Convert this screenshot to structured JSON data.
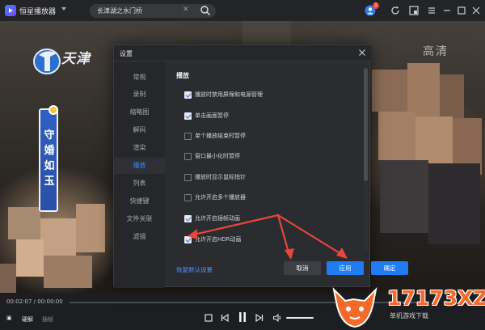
{
  "app": {
    "name": "恒星播放器"
  },
  "search": {
    "query": "长津湖之水门桥"
  },
  "notifications": {
    "count": "1"
  },
  "video": {
    "channel_logo_text": "天津",
    "quality_badge": "高清",
    "drama_title": "守婚如玉"
  },
  "dialog": {
    "title": "设置",
    "nav": [
      {
        "label": "常规"
      },
      {
        "label": "录制"
      },
      {
        "label": "缩略图"
      },
      {
        "label": "解码"
      },
      {
        "label": "渲染"
      },
      {
        "label": "播放"
      },
      {
        "label": "列表"
      },
      {
        "label": "快捷键"
      },
      {
        "label": "文件关联"
      },
      {
        "label": "滤镜"
      }
    ],
    "active_nav": "播放",
    "section_title": "播放",
    "options": [
      {
        "label": "播放时禁用屏保和电源管理",
        "checked": true
      },
      {
        "label": "单击画面暂停",
        "checked": true
      },
      {
        "label": "单个播放结束时暂停",
        "checked": false
      },
      {
        "label": "窗口最小化时暂停",
        "checked": false
      },
      {
        "label": "播放时显示鼠标指针",
        "checked": false
      },
      {
        "label": "允许开启多个播放器",
        "checked": false
      },
      {
        "label": "允许开启插帧动画",
        "checked": true
      },
      {
        "label": "允许开启HDR动画",
        "checked": true
      }
    ],
    "reset_label": "恢复默认设置",
    "cancel_label": "取消",
    "apply_label": "应用",
    "ok_label": "确定"
  },
  "player": {
    "time": "00:02:07 / 00:00:00",
    "hw_decode_label": "硬解",
    "plugin_label": "插帧"
  },
  "watermark": {
    "text": "17173XZ",
    "sub": "单机游戏下载"
  },
  "colors": {
    "accent": "#1f7cf2",
    "link": "#4a93ff",
    "arrow": "#e8463c",
    "watermark": "#f36a2a"
  }
}
